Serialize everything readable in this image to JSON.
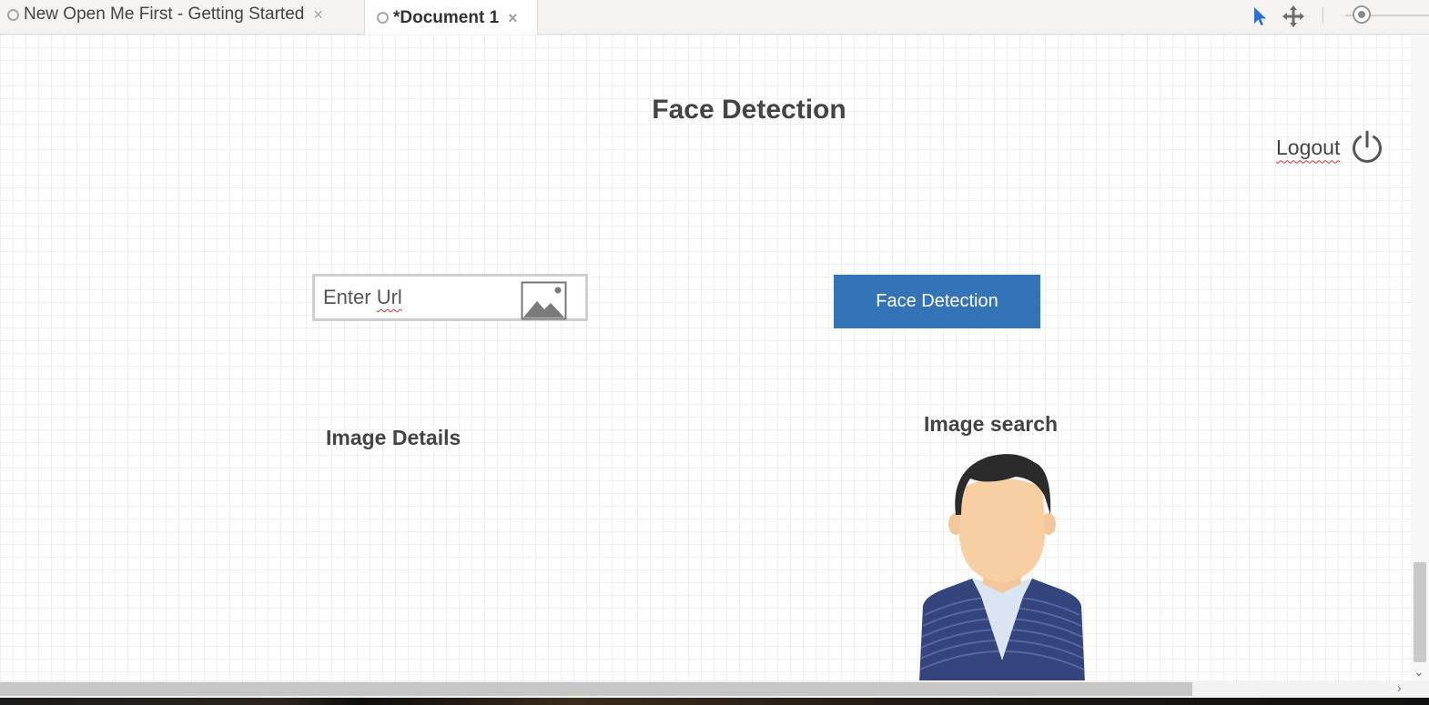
{
  "tabs": [
    {
      "label": "New Open Me First - Getting Started",
      "close": "×",
      "active": false
    },
    {
      "label": "*Document 1",
      "close": "×",
      "active": true
    }
  ],
  "toolbar": {
    "icons": [
      "pointer-icon",
      "move-icon"
    ],
    "accent": "#2f6fd0"
  },
  "canvas": {
    "title": "Face Detection",
    "logout_label": "Logout",
    "url_input": {
      "placeholder_prefix": "Enter ",
      "placeholder_misspelled": "Url"
    },
    "face_button_label": "Face Detection",
    "image_details_label": "Image Details",
    "image_search_label": "Image search",
    "button_color": "#3573b9"
  },
  "scroll": {
    "right_arrow": "›",
    "down_arrow": "⌄"
  }
}
